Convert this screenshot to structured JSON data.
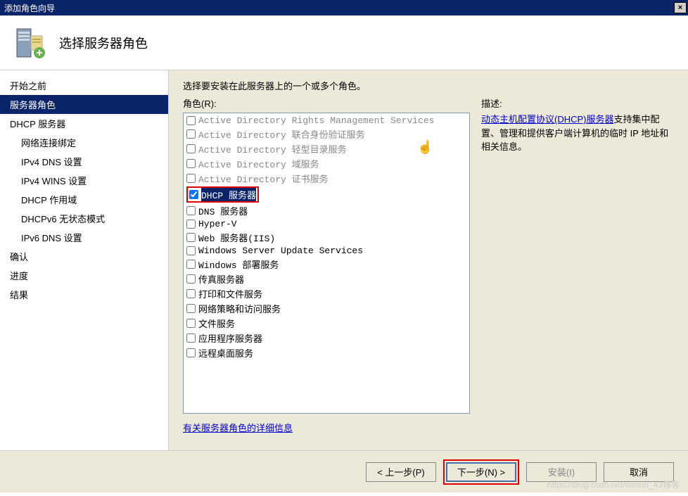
{
  "window": {
    "title": "添加角色向导",
    "close": "×"
  },
  "header": {
    "title": "选择服务器角色"
  },
  "sidebar": {
    "items": [
      {
        "label": "开始之前",
        "selected": false,
        "indent": 0
      },
      {
        "label": "服务器角色",
        "selected": true,
        "indent": 0
      },
      {
        "label": "DHCP 服务器",
        "selected": false,
        "indent": 0
      },
      {
        "label": "网络连接绑定",
        "selected": false,
        "indent": 1
      },
      {
        "label": "IPv4 DNS 设置",
        "selected": false,
        "indent": 1
      },
      {
        "label": "IPv4 WINS 设置",
        "selected": false,
        "indent": 1
      },
      {
        "label": "DHCP 作用域",
        "selected": false,
        "indent": 1
      },
      {
        "label": "DHCPv6 无状态模式",
        "selected": false,
        "indent": 1
      },
      {
        "label": "IPv6 DNS 设置",
        "selected": false,
        "indent": 1
      },
      {
        "label": "确认",
        "selected": false,
        "indent": 0
      },
      {
        "label": "进度",
        "selected": false,
        "indent": 0
      },
      {
        "label": "结果",
        "selected": false,
        "indent": 0
      }
    ]
  },
  "main": {
    "instruction": "选择要安装在此服务器上的一个或多个角色。",
    "roles_label": "角色(R):",
    "roles": [
      {
        "label": "Active Directory Rights Management Services",
        "checked": false,
        "disabled": true
      },
      {
        "label": "Active Directory 联合身份验证服务",
        "checked": false,
        "disabled": true
      },
      {
        "label": "Active Directory 轻型目录服务",
        "checked": false,
        "disabled": true
      },
      {
        "label": "Active Directory 域服务",
        "checked": false,
        "disabled": true
      },
      {
        "label": "Active Directory 证书服务",
        "checked": false,
        "disabled": true
      },
      {
        "label": "DHCP 服务器",
        "checked": true,
        "disabled": false,
        "highlighted": true,
        "redbox": true
      },
      {
        "label": "DNS 服务器",
        "checked": false,
        "disabled": false
      },
      {
        "label": "Hyper-V",
        "checked": false,
        "disabled": false
      },
      {
        "label": "Web 服务器(IIS)",
        "checked": false,
        "disabled": false
      },
      {
        "label": "Windows Server Update Services",
        "checked": false,
        "disabled": false
      },
      {
        "label": "Windows 部署服务",
        "checked": false,
        "disabled": false
      },
      {
        "label": "传真服务器",
        "checked": false,
        "disabled": false
      },
      {
        "label": "打印和文件服务",
        "checked": false,
        "disabled": false
      },
      {
        "label": "网络策略和访问服务",
        "checked": false,
        "disabled": false
      },
      {
        "label": "文件服务",
        "checked": false,
        "disabled": false
      },
      {
        "label": "应用程序服务器",
        "checked": false,
        "disabled": false
      },
      {
        "label": "远程桌面服务",
        "checked": false,
        "disabled": false
      }
    ],
    "desc_title": "描述:",
    "desc_link": "动态主机配置协议(DHCP)服务器",
    "desc_text": "支持集中配置、管理和提供客户端计算机的临时 IP 地址和相关信息。",
    "more_link": "有关服务器角色的详细信息"
  },
  "buttons": {
    "prev": "< 上一步(P)",
    "next": "下一步(N) >",
    "install": "安装(I)",
    "cancel": "取消"
  },
  "watermark": "https://blog.csdn.net/weixin_43博客"
}
